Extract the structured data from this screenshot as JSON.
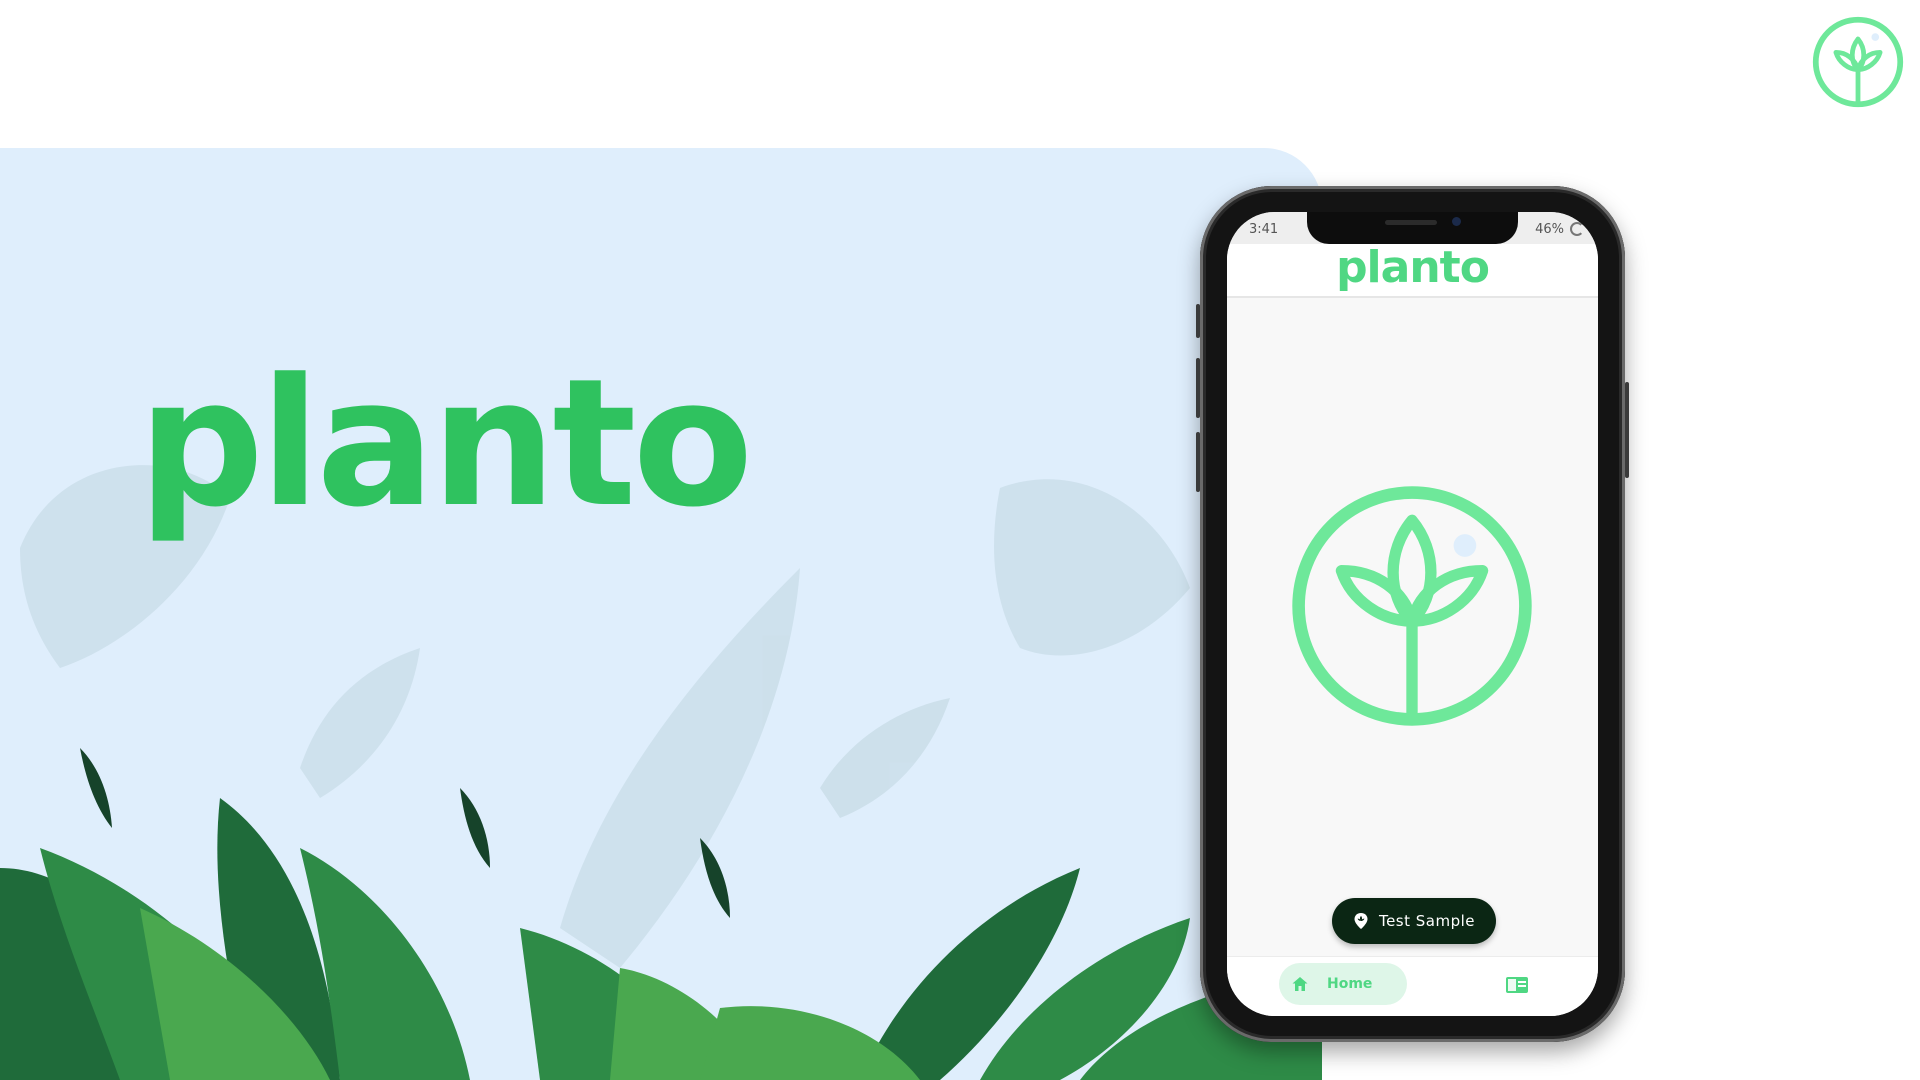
{
  "hero": {
    "wordmark": "planto"
  },
  "phone": {
    "status": {
      "time": "3:41",
      "battery": "46%"
    },
    "header": {
      "wordmark": "planto"
    },
    "action_button": {
      "label": "Test Sample",
      "icon": "plant-scan-icon"
    },
    "bottom_nav": {
      "items": [
        {
          "label": "Home",
          "icon": "home-icon",
          "active": true
        },
        {
          "label": "",
          "icon": "library-icon",
          "active": false
        }
      ]
    }
  },
  "colors": {
    "brand_green": "#4fd783",
    "hero_green": "#2fc25f",
    "hero_background": "#dfeefc",
    "button_dark": "#0b2614",
    "nav_active_bg": "#def6e8"
  },
  "icons": [
    "plant-logo-icon",
    "plant-scan-icon",
    "home-icon",
    "library-icon"
  ]
}
